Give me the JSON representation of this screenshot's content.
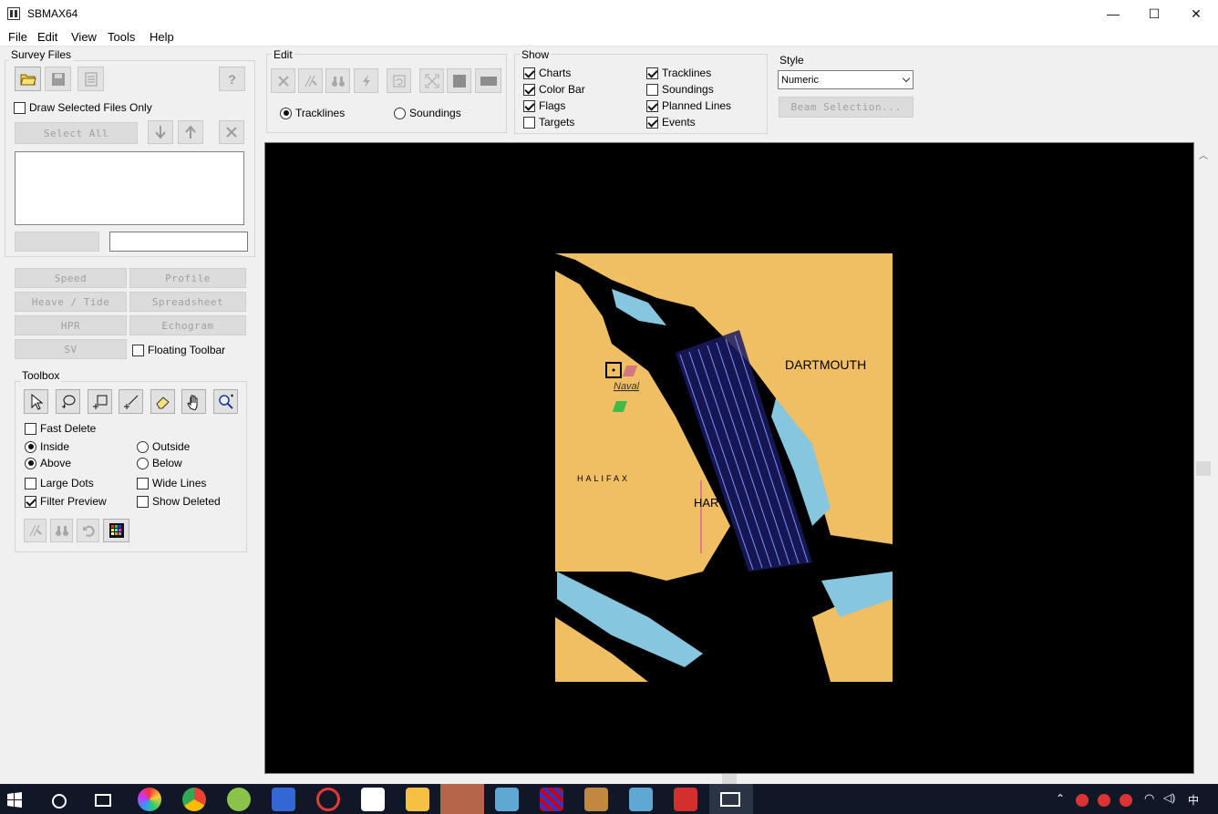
{
  "window": {
    "title": "SBMAX64",
    "controls": {
      "minimize": "—",
      "maximize": "☐",
      "close": "✕"
    }
  },
  "menu": [
    "File",
    "Edit",
    "View",
    "Tools",
    "Help"
  ],
  "survey_files": {
    "title": "Survey Files",
    "draw_selected_label": "Draw Selected Files Only",
    "draw_selected_checked": false,
    "select_all_label": "Select All",
    "file_list": [],
    "text_value": ""
  },
  "panels": {
    "speed": "Speed",
    "profile": "Profile",
    "heave_tide": "Heave / Tide",
    "spreadsheet": "Spreadsheet",
    "hpr": "HPR",
    "echogram": "Echogram",
    "sv": "SV",
    "floating_toolbar": "Floating Toolbar"
  },
  "toolbox": {
    "title": "Toolbox",
    "fast_delete": "Fast Delete",
    "inside": "Inside",
    "outside": "Outside",
    "above": "Above",
    "below": "Below",
    "large_dots": "Large Dots",
    "wide_lines": "Wide Lines",
    "filter_preview": "Filter Preview",
    "show_deleted": "Show Deleted"
  },
  "edit": {
    "title": "Edit",
    "tracklines": "Tracklines",
    "soundings": "Soundings"
  },
  "show": {
    "title": "Show",
    "items": [
      {
        "label": "Charts",
        "checked": true
      },
      {
        "label": "Color Bar",
        "checked": true
      },
      {
        "label": "Flags",
        "checked": true
      },
      {
        "label": "Targets",
        "checked": false
      },
      {
        "label": "Tracklines",
        "checked": true
      },
      {
        "label": "Soundings",
        "checked": false
      },
      {
        "label": "Planned Lines",
        "checked": true
      },
      {
        "label": "Events",
        "checked": true
      }
    ]
  },
  "style": {
    "title": "Style",
    "selected": "Numeric",
    "beam_selection": "Beam Selection..."
  },
  "map": {
    "labels": {
      "dartmouth": "DARTMOUTH",
      "halifax": "HALIFAX",
      "naval": "Naval",
      "harbour": "HAR"
    },
    "colors": {
      "land": "#f0bf63",
      "water": "#000000",
      "shallow": "#86c6de",
      "tracks": "#7f95ff",
      "flag_red": "#d57683",
      "flag_green": "#3fb949"
    }
  },
  "taskbar": {
    "clock": "中",
    "apps": [
      "windows-start",
      "cortana",
      "task-view",
      "photos",
      "chrome",
      "app-green",
      "app-screen",
      "app-red",
      "app-baidu",
      "explorer",
      "app-avatar",
      "app-whale-1",
      "app-pattern",
      "app-tool",
      "app-whale-2",
      "app-shield",
      "app-sbmax"
    ]
  }
}
